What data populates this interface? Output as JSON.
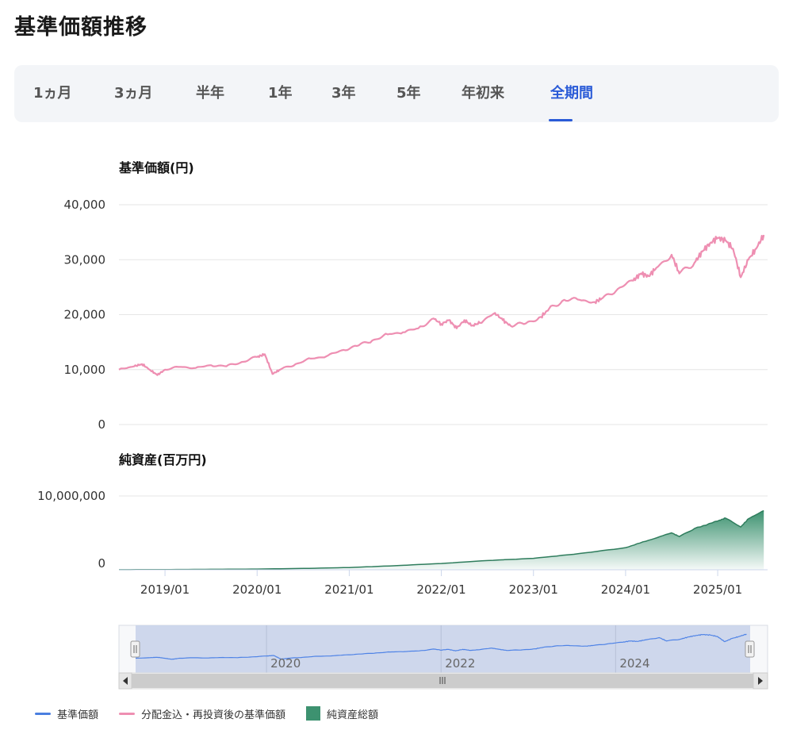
{
  "page": {
    "title": "基準価額推移"
  },
  "tabs": [
    {
      "label": "1ヵ月",
      "active": false
    },
    {
      "label": "3ヵ月",
      "active": false
    },
    {
      "label": "半年",
      "active": false
    },
    {
      "label": "1年",
      "active": false
    },
    {
      "label": "3年",
      "active": false
    },
    {
      "label": "5年",
      "active": false
    },
    {
      "label": "年初来",
      "active": false
    },
    {
      "label": "全期間",
      "active": true
    }
  ],
  "chart_data": [
    {
      "type": "line",
      "title": "基準価額(円)",
      "ylim": [
        0,
        40000
      ],
      "y_ticks": [
        "0",
        "10,000",
        "20,000",
        "30,000",
        "40,000"
      ],
      "grid": true,
      "series": [
        {
          "name": "分配金込・再投資後の基準価額",
          "color": "#ee8fb2",
          "x": [
            "2018-07",
            "2018-09",
            "2018-10",
            "2018-11",
            "2018-12",
            "2019-01",
            "2019-03",
            "2019-05",
            "2019-07",
            "2019-09",
            "2019-11",
            "2020-01",
            "2020-02",
            "2020-03",
            "2020-04",
            "2020-06",
            "2020-08",
            "2020-10",
            "2020-12",
            "2021-02",
            "2021-04",
            "2021-06",
            "2021-08",
            "2021-10",
            "2021-12",
            "2022-01",
            "2022-02",
            "2022-03",
            "2022-04",
            "2022-05",
            "2022-06",
            "2022-08",
            "2022-09",
            "2022-10",
            "2022-12",
            "2023-02",
            "2023-03",
            "2023-05",
            "2023-07",
            "2023-09",
            "2023-10",
            "2023-12",
            "2024-02",
            "2024-03",
            "2024-04",
            "2024-05",
            "2024-07",
            "2024-08",
            "2024-10",
            "2024-11",
            "2024-12",
            "2025-01",
            "2025-02",
            "2025-03",
            "2025-04",
            "2025-05",
            "2025-06",
            "2025-07"
          ],
          "values": [
            10000,
            10600,
            11000,
            10000,
            9000,
            10000,
            10500,
            10300,
            10800,
            10600,
            11400,
            12300,
            12800,
            9200,
            10000,
            11000,
            12000,
            12400,
            13500,
            14300,
            15300,
            16400,
            16800,
            17500,
            19300,
            18300,
            19000,
            17500,
            19000,
            18000,
            18500,
            20300,
            19000,
            18000,
            18400,
            19600,
            21000,
            22700,
            22700,
            22300,
            23000,
            24700,
            26200,
            27500,
            27000,
            28500,
            30900,
            27500,
            29500,
            31500,
            33000,
            34000,
            33500,
            32000,
            26800,
            30000,
            32000,
            34500
          ]
        }
      ]
    },
    {
      "type": "area",
      "title": "純資産(百万円)",
      "ylim": [
        0,
        10000000
      ],
      "y_ticks": [
        "0",
        "10,000,000"
      ],
      "x_ticks": [
        "2019/01",
        "2020/01",
        "2021/01",
        "2022/01",
        "2023/01",
        "2024/01",
        "2025/01"
      ],
      "grid": true,
      "series": [
        {
          "name": "純資産総額",
          "color": "#3d9270",
          "x": [
            "2018-07",
            "2019-01",
            "2019-07",
            "2020-01",
            "2020-07",
            "2021-01",
            "2021-07",
            "2022-01",
            "2022-07",
            "2023-01",
            "2023-07",
            "2024-01",
            "2024-04",
            "2024-07",
            "2024-08",
            "2024-10",
            "2025-01",
            "2025-02",
            "2025-04",
            "2025-05",
            "2025-07"
          ],
          "values": [
            10000,
            30000,
            60000,
            100000,
            180000,
            300000,
            550000,
            850000,
            1250000,
            1550000,
            2200000,
            3000000,
            4000000,
            5000000,
            4500000,
            5600000,
            6600000,
            7000000,
            5800000,
            6900000,
            8000000
          ]
        }
      ]
    }
  ],
  "navigator": {
    "year_labels": [
      "2020",
      "2022",
      "2024"
    ],
    "series_color": "#4f83e6"
  },
  "legend": [
    {
      "label": "基準価額",
      "kind": "line",
      "color": "#4a7fe0"
    },
    {
      "label": "分配金込・再投資後の基準価額",
      "kind": "line",
      "color": "#ee8fb2"
    },
    {
      "label": "純資産総額",
      "kind": "box",
      "color": "#3d9270"
    }
  ]
}
